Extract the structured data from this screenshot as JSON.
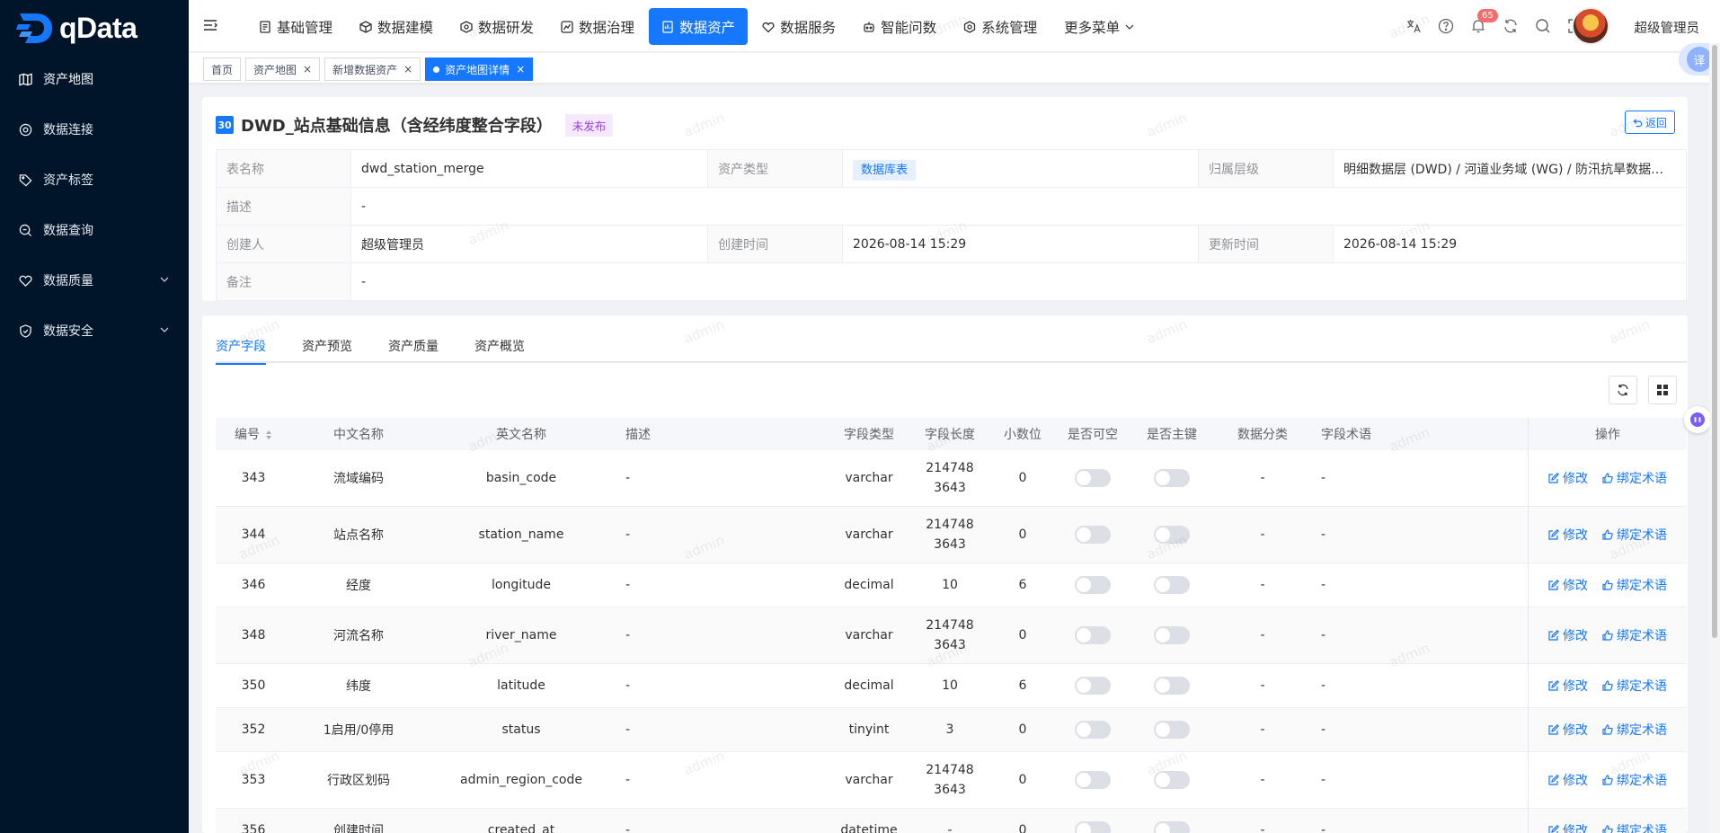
{
  "app": {
    "name": "qData"
  },
  "sidebar": {
    "items": [
      {
        "label": "资产地图",
        "icon": "map-icon",
        "active": true
      },
      {
        "label": "数据连接",
        "icon": "connection-icon"
      },
      {
        "label": "资产标签",
        "icon": "tag-icon"
      },
      {
        "label": "数据查询",
        "icon": "query-icon"
      },
      {
        "label": "数据质量",
        "icon": "quality-icon",
        "expandable": true
      },
      {
        "label": "数据安全",
        "icon": "shield-icon",
        "expandable": true
      }
    ]
  },
  "topnav": {
    "items": [
      {
        "label": "基础管理",
        "icon": "doc-icon"
      },
      {
        "label": "数据建模",
        "icon": "cube-icon"
      },
      {
        "label": "数据研发",
        "icon": "cube-icon"
      },
      {
        "label": "数据治理",
        "icon": "governance-icon"
      },
      {
        "label": "数据资产",
        "icon": "asset-icon",
        "active": true
      },
      {
        "label": "数据服务",
        "icon": "service-icon"
      },
      {
        "label": "智能问数",
        "icon": "robot-icon"
      },
      {
        "label": "系统管理",
        "icon": "settings-icon"
      },
      {
        "label": "更多菜单",
        "icon": "chevron-down-icon"
      }
    ],
    "notification_count": "65",
    "username": "超级管理员"
  },
  "tags": [
    {
      "label": "首页"
    },
    {
      "label": "资产地图",
      "closable": true
    },
    {
      "label": "新增数据资产",
      "closable": true
    },
    {
      "label": "资产地图详情",
      "closable": true,
      "active": true
    }
  ],
  "translate_label": "译",
  "watermark": "admin",
  "detail": {
    "number": "30",
    "title": "DWD_站点基础信息（含经纬度整合字段）",
    "status": "未发布",
    "back_label": "返回",
    "fields": {
      "table_name_label": "表名称",
      "table_name": "dwd_station_merge",
      "asset_type_label": "资产类型",
      "asset_type": "数据库表",
      "layer_label": "归属层级",
      "layer": "明细数据层 (DWD) / 河道业务域 (WG) / 防汛抗旱数据…",
      "desc_label": "描述",
      "desc": "-",
      "creator_label": "创建人",
      "creator": "超级管理员",
      "created_label": "创建时间",
      "created": "2026-08-14 15:29",
      "updated_label": "更新时间",
      "updated": "2026-08-14 15:29",
      "remark_label": "备注",
      "remark": "-"
    }
  },
  "tabs": [
    {
      "label": "资产字段",
      "active": true
    },
    {
      "label": "资产预览"
    },
    {
      "label": "资产质量"
    },
    {
      "label": "资产概览"
    }
  ],
  "table": {
    "headers": {
      "id": "编号",
      "cn": "中文名称",
      "en": "英文名称",
      "desc": "描述",
      "type": "字段类型",
      "len": "字段长度",
      "dec": "小数位",
      "nullable": "是否可空",
      "pk": "是否主键",
      "cls": "数据分类",
      "term": "字段术语",
      "ops": "操作"
    },
    "edit_label": "修改",
    "bind_label": "绑定术语",
    "rows": [
      {
        "id": "343",
        "cn": "流域编码",
        "en": "basin_code",
        "desc": "-",
        "type": "varchar",
        "len1": "214748",
        "len2": "3643",
        "dec": "0",
        "cls": "-",
        "term": "-"
      },
      {
        "id": "344",
        "cn": "站点名称",
        "en": "station_name",
        "desc": "-",
        "type": "varchar",
        "len1": "214748",
        "len2": "3643",
        "dec": "0",
        "cls": "-",
        "term": "-"
      },
      {
        "id": "346",
        "cn": "经度",
        "en": "longitude",
        "desc": "-",
        "type": "decimal",
        "len1": "10",
        "len2": "",
        "dec": "6",
        "cls": "-",
        "term": "-"
      },
      {
        "id": "348",
        "cn": "河流名称",
        "en": "river_name",
        "desc": "-",
        "type": "varchar",
        "len1": "214748",
        "len2": "3643",
        "dec": "0",
        "cls": "-",
        "term": "-"
      },
      {
        "id": "350",
        "cn": "纬度",
        "en": "latitude",
        "desc": "-",
        "type": "decimal",
        "len1": "10",
        "len2": "",
        "dec": "6",
        "cls": "-",
        "term": "-"
      },
      {
        "id": "352",
        "cn": "1启用/0停用",
        "en": "status",
        "desc": "-",
        "type": "tinyint",
        "len1": "3",
        "len2": "",
        "dec": "0",
        "cls": "-",
        "term": "-"
      },
      {
        "id": "353",
        "cn": "行政区划码",
        "en": "admin_region_code",
        "desc": "-",
        "type": "varchar",
        "len1": "214748",
        "len2": "3643",
        "dec": "0",
        "cls": "-",
        "term": "-"
      },
      {
        "id": "356",
        "cn": "创建时间",
        "en": "created_at",
        "desc": "-",
        "type": "datetime",
        "len1": "-",
        "len2": "",
        "dec": "0",
        "cls": "-",
        "term": "-"
      }
    ]
  }
}
